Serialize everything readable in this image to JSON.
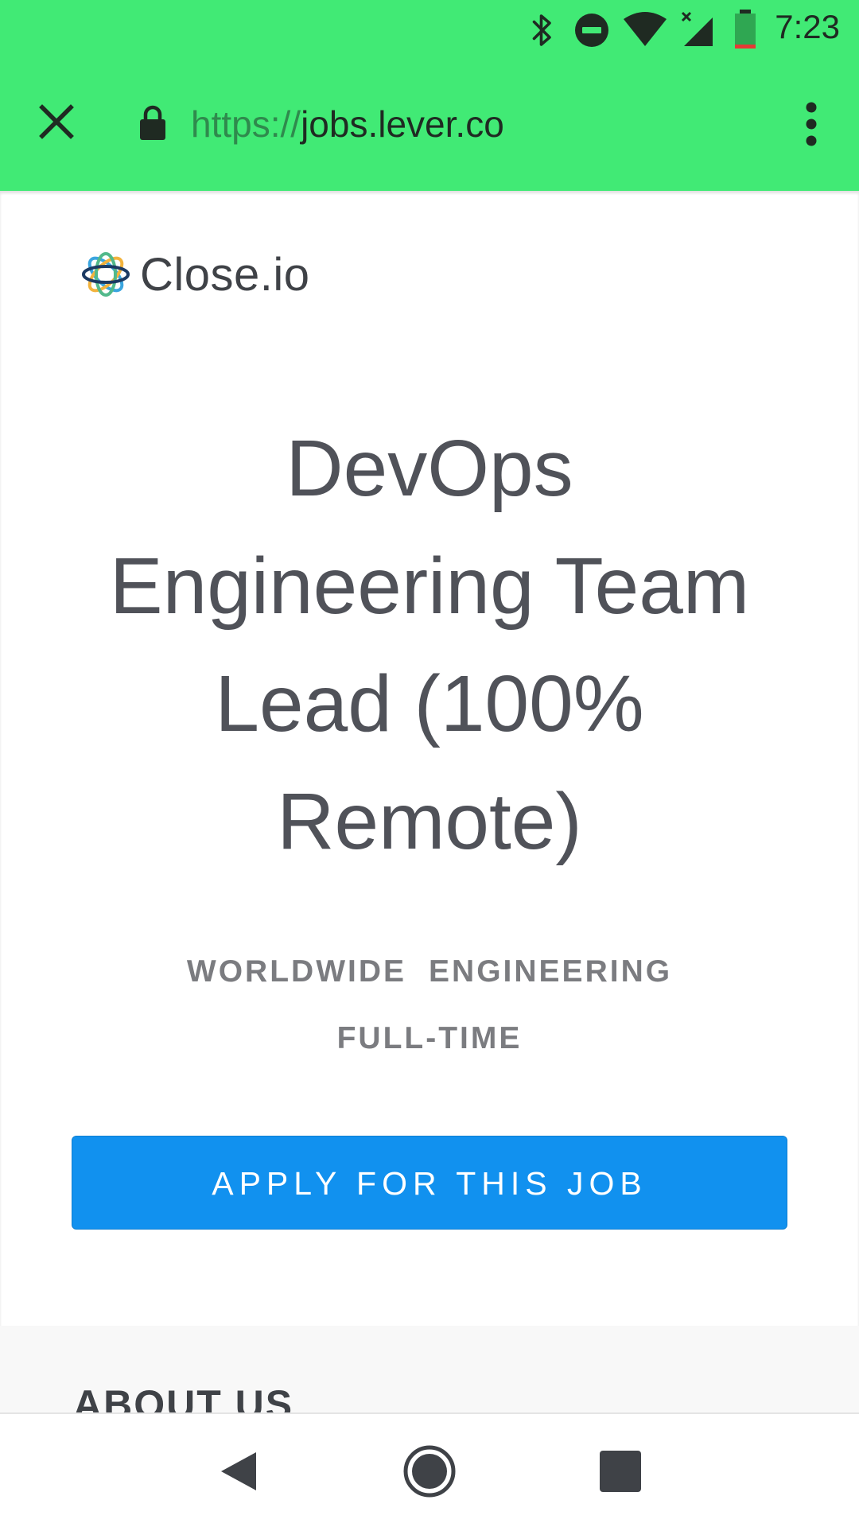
{
  "status_bar": {
    "time": "7:23",
    "icons": [
      "bluetooth-icon",
      "do-not-disturb-icon",
      "wifi-icon",
      "cell-signal-icon",
      "battery-icon"
    ]
  },
  "browser": {
    "close_icon": "close-icon",
    "lock_icon": "lock-icon",
    "url_scheme": "https://",
    "url_host": "jobs.lever.co",
    "menu_icon": "overflow-menu-icon",
    "toolbar_color": "#41ea75"
  },
  "page": {
    "company_name": "Close.io",
    "job_title": "DevOps Engineering Team Lead (100% Remote)",
    "categories": {
      "location": "WORLDWIDE",
      "team": "ENGINEERING",
      "commitment": "FULL-TIME"
    },
    "apply_label": "APPLY FOR THIS JOB",
    "apply_color": "#1191ef",
    "about_heading": "ABOUT US"
  },
  "nav_bar": {
    "back_icon": "back-icon",
    "home_icon": "home-icon",
    "recents_icon": "recents-icon"
  }
}
